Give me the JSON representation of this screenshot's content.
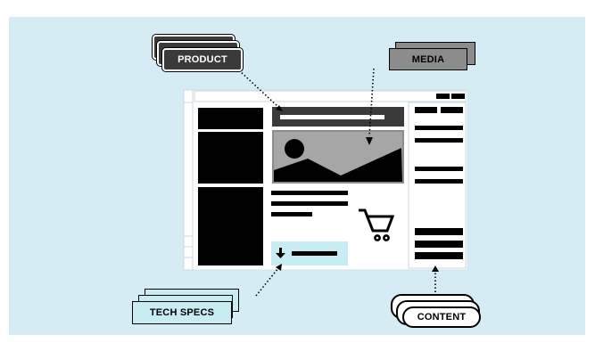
{
  "labels": {
    "product": "PRODUCT",
    "media": "MEDIA",
    "tech_specs": "TECH SPECS",
    "content": "CONTENT"
  },
  "colors": {
    "background": "#d6ecf4",
    "dark_block": "#000000",
    "page_white": "#ffffff",
    "product_card": "#3a3a3a",
    "media_card": "#8c8c8c",
    "media_image_gray": "#a6a6a6",
    "tech_specs_card": "#c8ecf4",
    "content_card": "#ffffff"
  },
  "icons": [
    "shopping-cart-icon",
    "download-arrow-icon",
    "mountain-image-icon"
  ]
}
